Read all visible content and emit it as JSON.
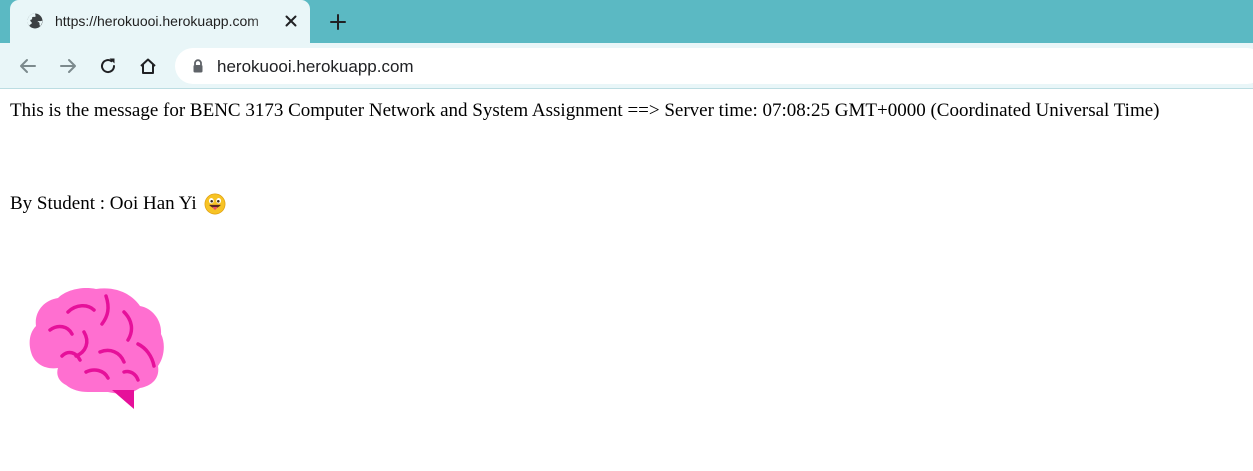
{
  "browser": {
    "tab": {
      "title": "https://herokuooi.herokuapp.com",
      "favicon": "globe-icon",
      "close_icon": "close-icon"
    },
    "new_tab_icon": "plus-icon",
    "toolbar": {
      "back_icon": "arrow-left-icon",
      "forward_icon": "arrow-right-icon",
      "reload_icon": "reload-icon",
      "home_icon": "home-icon",
      "lock_icon": "lock-icon",
      "url": "herokuooi.herokuapp.com"
    },
    "colors": {
      "tabstrip": "#5bb9c3",
      "toolbar": "#e9f6f8"
    }
  },
  "page": {
    "message": "This is the message for BENC 3173 Computer Network and System Assignment ==> Server time: 07:08:25 GMT+0000 (Coordinated Universal Time)",
    "student_line": "By Student : Ooi Han Yi",
    "student_emoji": "tongue-out-face-emoji",
    "image": "brain-emoji"
  }
}
